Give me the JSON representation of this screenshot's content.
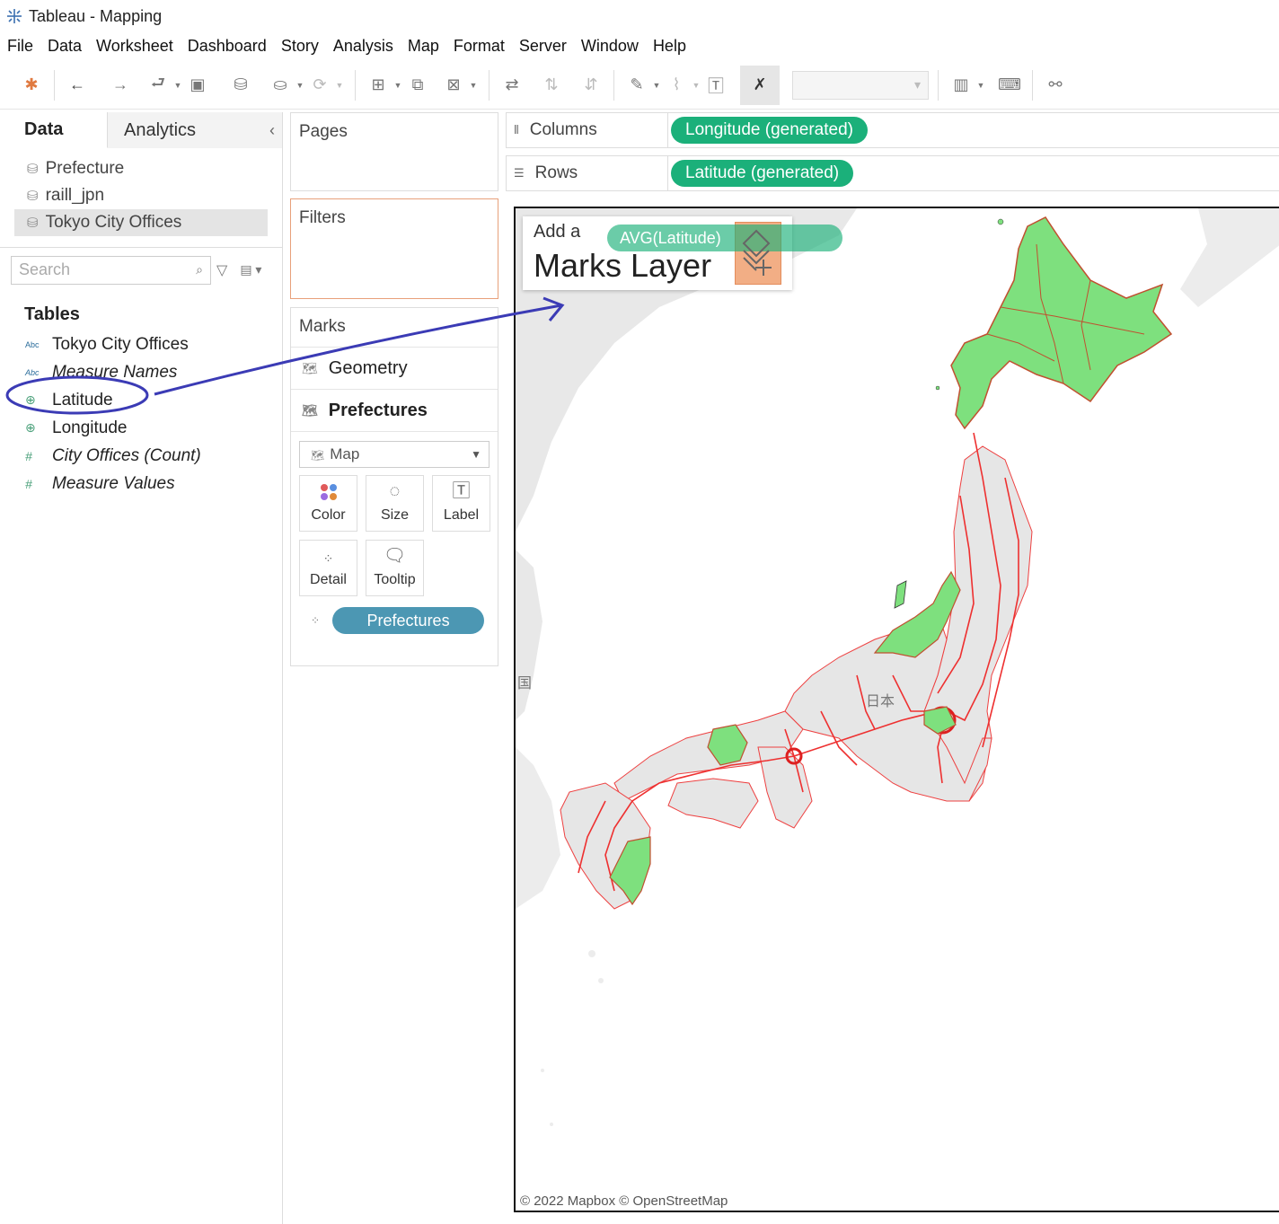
{
  "window": {
    "title": "Tableau - Mapping"
  },
  "menu": [
    "File",
    "Data",
    "Worksheet",
    "Dashboard",
    "Story",
    "Analysis",
    "Map",
    "Format",
    "Server",
    "Window",
    "Help"
  ],
  "left_pane": {
    "tabs": {
      "data": "Data",
      "analytics": "Analytics",
      "collapse": "‹"
    },
    "data_sources": [
      "Prefecture",
      "raill_jpn",
      "Tokyo City Offices"
    ],
    "search_placeholder": "Search",
    "tables_heading": "Tables",
    "fields": [
      {
        "type": "Abc",
        "name": "Tokyo City Offices"
      },
      {
        "type": "Abc",
        "name": "Measure Names"
      },
      {
        "type": "geo",
        "name": "Latitude"
      },
      {
        "type": "geo",
        "name": "Longitude"
      },
      {
        "type": "#",
        "name": "City Offices (Count)"
      },
      {
        "type": "#",
        "name": "Measure Values"
      }
    ]
  },
  "cards": {
    "pages": "Pages",
    "filters": "Filters",
    "marks": "Marks",
    "mark_layers": [
      "Geometry",
      "Prefectures"
    ],
    "mark_type": "Map",
    "mark_buttons": [
      "Color",
      "Size",
      "Label",
      "Detail",
      "Tooltip"
    ],
    "detail_pill": "Prefectures"
  },
  "shelves": {
    "columns_label": "Columns",
    "columns_pill": "Longitude (generated)",
    "rows_label": "Rows",
    "rows_pill": "Latitude (generated)"
  },
  "viz": {
    "add_layer_line1": "Add a",
    "add_layer_line2": "Marks Layer",
    "drag_pill": "AVG(Latitude)",
    "map_label_japan": "日本",
    "map_label_korea": "国",
    "attribution": "© 2022 Mapbox © OpenStreetMap"
  },
  "colors": {
    "green_pill": "#1bb07a",
    "blue_pill": "#4c97b3",
    "highlight_prefecture": "#7ee07e",
    "rail_lines": "#e83030",
    "annotation": "#3b3bb5"
  }
}
